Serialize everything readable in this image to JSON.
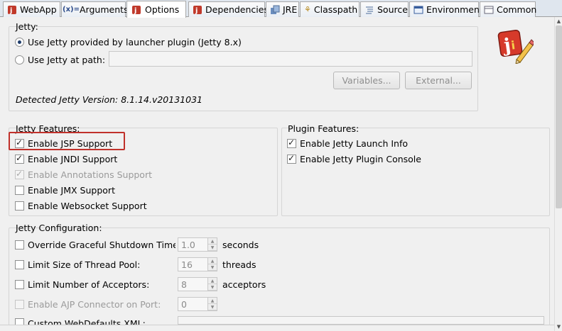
{
  "tabs": [
    {
      "label": "WebApp",
      "icon": "jetty-icon"
    },
    {
      "label": "Arguments",
      "icon": "arguments-icon"
    },
    {
      "label": "Options",
      "icon": "jetty-icon",
      "active": true
    },
    {
      "label": "Dependencies",
      "icon": "jetty-icon"
    },
    {
      "label": "JRE",
      "icon": "jre-icon"
    },
    {
      "label": "Classpath",
      "icon": "classpath-icon"
    },
    {
      "label": "Source",
      "icon": "source-icon"
    },
    {
      "label": "Environment",
      "icon": "environment-icon"
    },
    {
      "label": "Common",
      "icon": "common-icon"
    }
  ],
  "jetty": {
    "group_label": "Jetty:",
    "radio_launcher": "Use Jetty provided by launcher plugin (Jetty 8.x)",
    "radio_path": "Use Jetty at path:",
    "path_value": "",
    "variables_button": "Variables...",
    "external_button": "External...",
    "detected_version": "Detected Jetty Version: 8.1.14.v20131031"
  },
  "features": {
    "group_label": "Jetty Features:",
    "items": [
      {
        "label": "Enable JSP Support",
        "checked": true,
        "disabled": false
      },
      {
        "label": "Enable JNDI Support",
        "checked": true,
        "disabled": false
      },
      {
        "label": "Enable Annotations Support",
        "checked": true,
        "disabled": true
      },
      {
        "label": "Enable JMX Support",
        "checked": false,
        "disabled": false
      },
      {
        "label": "Enable Websocket Support",
        "checked": false,
        "disabled": false
      }
    ]
  },
  "plugin": {
    "group_label": "Plugin Features:",
    "items": [
      {
        "label": "Enable Jetty Launch Info",
        "checked": true
      },
      {
        "label": "Enable Jetty Plugin Console",
        "checked": true
      }
    ]
  },
  "config": {
    "group_label": "Jetty Configuration:",
    "rows": [
      {
        "label": "Override Graceful Shutdown Timeou",
        "value": "1.0",
        "unit": "seconds",
        "disabled": false
      },
      {
        "label": "Limit Size of Thread Pool:",
        "value": "16",
        "unit": "threads",
        "disabled": false
      },
      {
        "label": "Limit Number of Acceptors:",
        "value": "8",
        "unit": "acceptors",
        "disabled": false
      },
      {
        "label": "Enable AJP Connector on Port:",
        "value": "0",
        "unit": "",
        "disabled": true
      }
    ],
    "partial_row_label": "Custom WebDefaults XML:"
  }
}
